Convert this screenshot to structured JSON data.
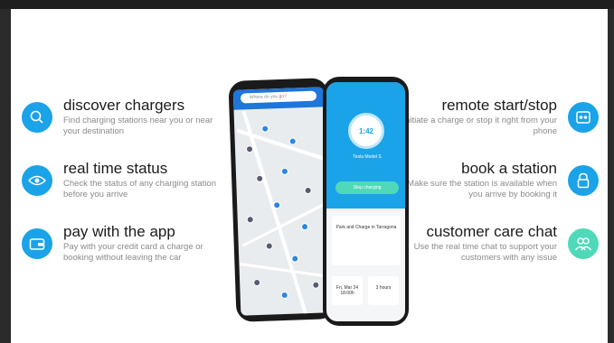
{
  "features_left": [
    {
      "title": "discover chargers",
      "desc": "Find charging stations near you or near your destination",
      "icon": "search-icon",
      "color": "#1aa3e8"
    },
    {
      "title": "real time status",
      "desc": "Check the status of any charging station before you arrive",
      "icon": "eye-icon",
      "color": "#1aa3e8"
    },
    {
      "title": "pay with the app",
      "desc": "Pay with your credit card a charge or booking without leaving the car",
      "icon": "wallet-icon",
      "color": "#1aa3e8"
    }
  ],
  "features_right": [
    {
      "title": "remote start/stop",
      "desc": "Initiate a charge or stop it right from your phone",
      "icon": "remote-icon",
      "color": "#1aa3e8"
    },
    {
      "title": "book a station",
      "desc": "Make sure the station is available when you arrive by booking it",
      "icon": "lock-icon",
      "color": "#1aa3e8"
    },
    {
      "title": "customer care chat",
      "desc": "Use the real time chat to support your customers with any issue",
      "icon": "users-icon",
      "color": "#4fd9b8"
    }
  ],
  "phone_map": {
    "search_placeholder": "Where do you go?"
  },
  "phone_app": {
    "charge_time": "1:42",
    "car_name": "Tesla Model S",
    "stop_label": "Stop charging",
    "station_name": "Park and Charge in Tarragona",
    "booking_date": "Fri, Mar 24",
    "booking_time": "18:00h",
    "booking_duration": "3 hours"
  }
}
